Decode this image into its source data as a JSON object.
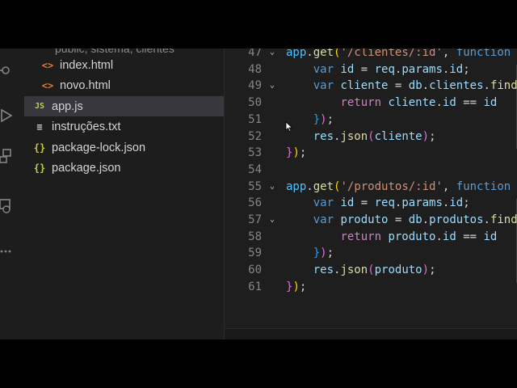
{
  "sidebar": {
    "cut_label": "public, sistema, clientes",
    "items": [
      {
        "name": "index.html",
        "icon": "html-file-icon",
        "symbol": "<>"
      },
      {
        "name": "novo.html",
        "icon": "html-file-icon",
        "symbol": "<>"
      },
      {
        "name": "app.js",
        "icon": "js-file-icon",
        "symbol": "JS",
        "selected": true
      },
      {
        "name": "instruções.txt",
        "icon": "text-file-icon",
        "symbol": "≡"
      },
      {
        "name": "package-lock.json",
        "icon": "json-file-icon",
        "symbol": "{}"
      },
      {
        "name": "package.json",
        "icon": "json-file-icon",
        "symbol": "{}"
      }
    ]
  },
  "activity_bar": {
    "icons": [
      "source-control-icon",
      "run-debug-icon",
      "extensions-icon",
      "remote-explorer-icon",
      "more-icon"
    ]
  },
  "editor": {
    "lines": [
      {
        "n": "47",
        "fold": true,
        "tokens": [
          [
            "obj",
            "app"
          ],
          [
            "punc",
            "."
          ],
          [
            "fn",
            "get"
          ],
          [
            "b1",
            "("
          ],
          [
            "str",
            "'/clientes/:id'"
          ],
          [
            "punc",
            ", "
          ],
          [
            "kw",
            "function"
          ],
          [
            "punc",
            " ("
          ]
        ]
      },
      {
        "n": "48",
        "fold": false,
        "tokens": [
          [
            "punc",
            "    "
          ],
          [
            "kw",
            "var"
          ],
          [
            "punc",
            " "
          ],
          [
            "var",
            "id"
          ],
          [
            "punc",
            " = "
          ],
          [
            "var",
            "req"
          ],
          [
            "punc",
            "."
          ],
          [
            "var",
            "params"
          ],
          [
            "punc",
            "."
          ],
          [
            "var",
            "id"
          ],
          [
            "punc",
            ";"
          ]
        ]
      },
      {
        "n": "49",
        "fold": true,
        "tokens": [
          [
            "punc",
            "    "
          ],
          [
            "kw",
            "var"
          ],
          [
            "punc",
            " "
          ],
          [
            "var",
            "cliente"
          ],
          [
            "punc",
            " = "
          ],
          [
            "var",
            "db"
          ],
          [
            "punc",
            "."
          ],
          [
            "var",
            "clientes"
          ],
          [
            "punc",
            "."
          ],
          [
            "fn",
            "find"
          ]
        ]
      },
      {
        "n": "50",
        "fold": false,
        "tokens": [
          [
            "punc",
            "        "
          ],
          [
            "ctl",
            "return"
          ],
          [
            "punc",
            " "
          ],
          [
            "var",
            "cliente"
          ],
          [
            "punc",
            "."
          ],
          [
            "var",
            "id"
          ],
          [
            "punc",
            " == "
          ],
          [
            "var",
            "id"
          ]
        ]
      },
      {
        "n": "51",
        "fold": false,
        "tokens": [
          [
            "punc",
            "    "
          ],
          [
            "b3",
            "}"
          ],
          [
            "b2",
            ")"
          ],
          [
            "punc",
            ";"
          ]
        ]
      },
      {
        "n": "52",
        "fold": false,
        "tokens": [
          [
            "punc",
            "    "
          ],
          [
            "var",
            "res"
          ],
          [
            "punc",
            "."
          ],
          [
            "fn",
            "json"
          ],
          [
            "b2",
            "("
          ],
          [
            "var",
            "cliente"
          ],
          [
            "b2",
            ")"
          ],
          [
            "punc",
            ";"
          ]
        ]
      },
      {
        "n": "53",
        "fold": false,
        "tokens": [
          [
            "b2",
            "}"
          ],
          [
            "b1",
            ")"
          ],
          [
            "punc",
            ";"
          ]
        ]
      },
      {
        "n": "54",
        "fold": false,
        "tokens": []
      },
      {
        "n": "55",
        "fold": true,
        "tokens": [
          [
            "obj",
            "app"
          ],
          [
            "punc",
            "."
          ],
          [
            "fn",
            "get"
          ],
          [
            "b1",
            "("
          ],
          [
            "str",
            "'/produtos/:id'"
          ],
          [
            "punc",
            ", "
          ],
          [
            "kw",
            "function"
          ],
          [
            "punc",
            " ("
          ]
        ]
      },
      {
        "n": "56",
        "fold": false,
        "tokens": [
          [
            "punc",
            "    "
          ],
          [
            "kw",
            "var"
          ],
          [
            "punc",
            " "
          ],
          [
            "var",
            "id"
          ],
          [
            "punc",
            " = "
          ],
          [
            "var",
            "req"
          ],
          [
            "punc",
            "."
          ],
          [
            "var",
            "params"
          ],
          [
            "punc",
            "."
          ],
          [
            "var",
            "id"
          ],
          [
            "punc",
            ";"
          ]
        ]
      },
      {
        "n": "57",
        "fold": true,
        "tokens": [
          [
            "punc",
            "    "
          ],
          [
            "kw",
            "var"
          ],
          [
            "punc",
            " "
          ],
          [
            "var",
            "produto"
          ],
          [
            "punc",
            " = "
          ],
          [
            "var",
            "db"
          ],
          [
            "punc",
            "."
          ],
          [
            "var",
            "produtos"
          ],
          [
            "punc",
            "."
          ],
          [
            "fn",
            "find"
          ]
        ]
      },
      {
        "n": "58",
        "fold": false,
        "tokens": [
          [
            "punc",
            "        "
          ],
          [
            "ctl",
            "return"
          ],
          [
            "punc",
            " "
          ],
          [
            "var",
            "produto"
          ],
          [
            "punc",
            "."
          ],
          [
            "var",
            "id"
          ],
          [
            "punc",
            " == "
          ],
          [
            "var",
            "id"
          ]
        ]
      },
      {
        "n": "59",
        "fold": false,
        "tokens": [
          [
            "punc",
            "    "
          ],
          [
            "b3",
            "}"
          ],
          [
            "b2",
            ")"
          ],
          [
            "punc",
            ";"
          ]
        ]
      },
      {
        "n": "60",
        "fold": false,
        "tokens": [
          [
            "punc",
            "    "
          ],
          [
            "var",
            "res"
          ],
          [
            "punc",
            "."
          ],
          [
            "fn",
            "json"
          ],
          [
            "b2",
            "("
          ],
          [
            "var",
            "produto"
          ],
          [
            "b2",
            ")"
          ],
          [
            "punc",
            ";"
          ]
        ]
      },
      {
        "n": "61",
        "fold": false,
        "tokens": [
          [
            "b2",
            "}"
          ],
          [
            "b1",
            ")"
          ],
          [
            "punc",
            ";"
          ]
        ]
      }
    ]
  },
  "colors": {
    "editor_bg": "#1e1e1e",
    "sidebar_bg": "#1d1d1d",
    "selected_bg": "#37373d"
  }
}
